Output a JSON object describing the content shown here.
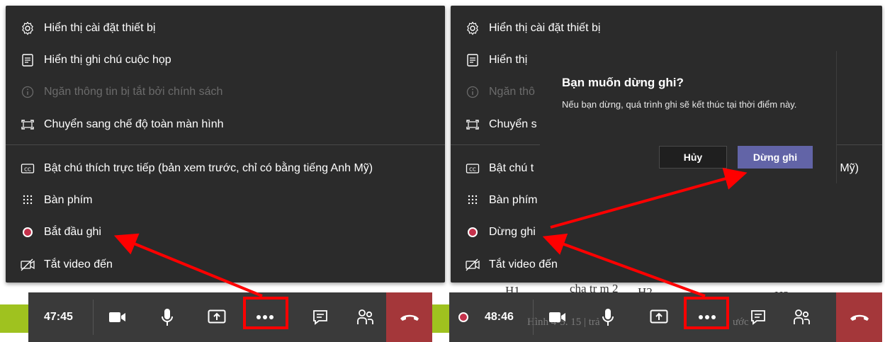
{
  "menu": {
    "device_settings": "Hiển thị cài đặt thiết bị",
    "meeting_notes": "Hiển thị ghi chú cuộc họp",
    "policy_block": "Ngăn thông tin bị tắt bởi chính sách",
    "fullscreen": "Chuyển sang chế độ toàn màn hình",
    "live_captions": "Bật chú thích trực tiếp (bản xem trước, chỉ có bằng tiếng Anh Mỹ)",
    "keypad": "Bàn phím",
    "start_recording": "Bắt đầu ghi",
    "turn_off_video": "Tắt video đến"
  },
  "menu_right": {
    "device_settings": "Hiển thị cài đặt thiết bị",
    "meeting_notes_cut": "Hiển thị",
    "policy_block_cut": "Ngăn thô",
    "fullscreen_cut": "Chuyển s",
    "live_captions_cut": "Bật chú t",
    "live_captions_tail": "h Mỹ)",
    "keypad_cut": "Bàn phím",
    "stop_recording": "Dừng ghi",
    "turn_off_video": "Tắt video đến"
  },
  "dialog": {
    "title": "Bạn muốn dừng ghi?",
    "body": "Nếu bạn dừng, quá trình ghi sẽ kết thúc tại thời điểm này.",
    "cancel": "Hủy",
    "confirm": "Dừng ghi"
  },
  "toolbar_left": {
    "timer": "47:45"
  },
  "toolbar_right": {
    "timer": "48:46"
  },
  "background": {
    "label_h1": "H1",
    "label_h2": "H2",
    "label_h3": "H3",
    "caption_fragment": "cha tr m 2",
    "bottom_left": "Hình 4-5. 15 | trả",
    "bottom_right": "ước"
  },
  "colors": {
    "panel": "#2b2b2b",
    "record_red": "#c4314b",
    "accent_purple": "#6264a7",
    "hangup_red": "#a4373a",
    "highlight_red": "#ff0000"
  }
}
